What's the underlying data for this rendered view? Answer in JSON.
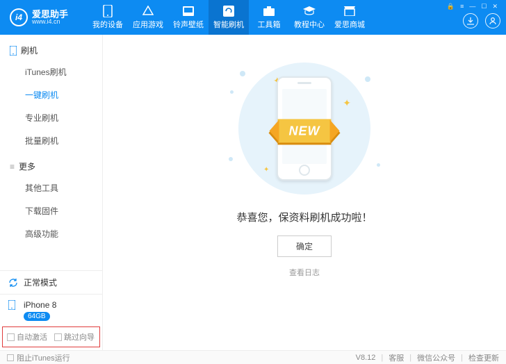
{
  "header": {
    "brand_name": "爱思助手",
    "brand_url": "www.i4.cn",
    "logo_text": "i4",
    "nav": [
      {
        "label": "我的设备"
      },
      {
        "label": "应用游戏"
      },
      {
        "label": "铃声壁纸"
      },
      {
        "label": "智能刷机"
      },
      {
        "label": "工具箱"
      },
      {
        "label": "教程中心"
      },
      {
        "label": "爱思商城"
      }
    ],
    "active_nav_index": 3
  },
  "sidebar": {
    "groups": [
      {
        "title": "刷机",
        "items": [
          "iTunes刷机",
          "一键刷机",
          "专业刷机",
          "批量刷机"
        ],
        "active_index": 1
      },
      {
        "title": "更多",
        "items": [
          "其他工具",
          "下载固件",
          "高级功能"
        ],
        "active_index": -1
      }
    ],
    "mode_label": "正常模式",
    "device_name": "iPhone 8",
    "device_storage": "64GB",
    "auto_activate_label": "自动激活",
    "skip_guide_label": "跳过向导"
  },
  "main": {
    "ribbon_text": "NEW",
    "message": "恭喜您，保资料刷机成功啦！",
    "ok_label": "确定",
    "log_link": "查看日志"
  },
  "footer": {
    "block_itunes": "阻止iTunes运行",
    "version": "V8.12",
    "support": "客服",
    "wechat": "微信公众号",
    "update": "检查更新"
  }
}
